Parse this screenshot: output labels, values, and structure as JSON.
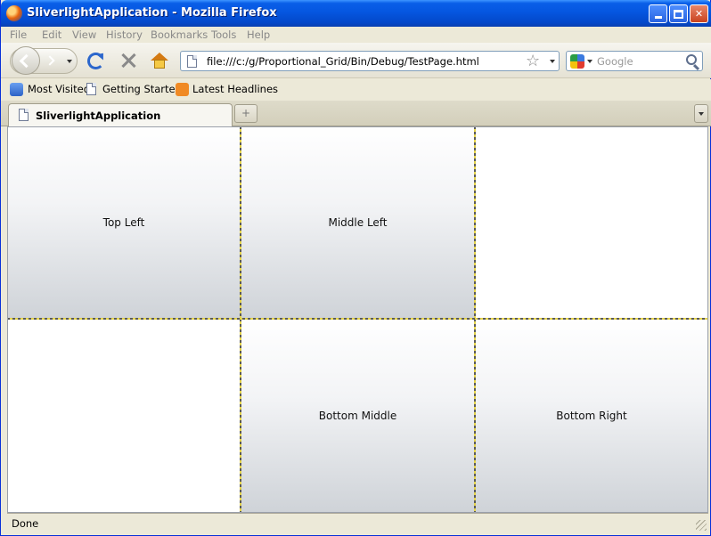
{
  "window": {
    "title": "SliverlightApplication - Mozilla Firefox"
  },
  "menu": {
    "items": [
      {
        "label": "File"
      },
      {
        "label": "Edit"
      },
      {
        "label": "View"
      },
      {
        "label": "History"
      },
      {
        "label": "Bookmarks"
      },
      {
        "label": "Tools"
      },
      {
        "label": "Help"
      }
    ]
  },
  "nav": {
    "url": "file:///c:/g/Proportional_Grid/Bin/Debug/TestPage.html",
    "search_placeholder": "Google"
  },
  "bookmarks": {
    "items": [
      {
        "label": "Most Visited",
        "icon": "most-visited-icon"
      },
      {
        "label": "Getting Started",
        "icon": "page-icon"
      },
      {
        "label": "Latest Headlines",
        "icon": "rss-icon"
      }
    ]
  },
  "tabs": [
    {
      "label": "SliverlightApplication",
      "active": true
    }
  ],
  "grid": {
    "cells": [
      {
        "label": "Top Left",
        "shaded": true
      },
      {
        "label": "Middle Left",
        "shaded": true
      },
      {
        "label": "",
        "shaded": false
      },
      {
        "label": "",
        "shaded": false
      },
      {
        "label": "Bottom Middle",
        "shaded": true
      },
      {
        "label": "Bottom Right",
        "shaded": true
      }
    ]
  },
  "status": {
    "text": "Done"
  },
  "colors": {
    "title_bar": "#0556e0",
    "grid_splitter_dark": "#5a5a5a",
    "grid_splitter_light": "#e5d44a"
  }
}
